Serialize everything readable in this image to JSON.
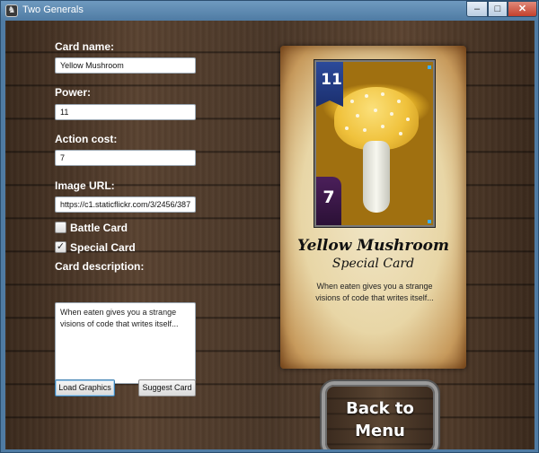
{
  "window": {
    "title": "Two Generals",
    "app_icon": "knight-helmet-icon",
    "buttons": {
      "minimize": "–",
      "maximize": "□",
      "close": "✕"
    }
  },
  "form": {
    "card_name_label": "Card name:",
    "card_name_value": "Yellow Mushroom",
    "power_label": "Power:",
    "power_value": "11",
    "action_cost_label": "Action cost:",
    "action_cost_value": "7",
    "image_url_label": "Image URL:",
    "image_url_value": "https://c1.staticflickr.com/3/2456/387",
    "battle_card_label": "Battle Card",
    "battle_card_checked": false,
    "special_card_label": "Special Card",
    "special_card_checked": true,
    "description_label": "Card description:",
    "description_value": "When eaten gives you a strange visions of code that writes itself...",
    "load_graphics_label": "Load Graphics",
    "suggest_card_label": "Suggest Card"
  },
  "card": {
    "power": "11",
    "cost": "7",
    "title": "Yellow Mushroom",
    "subtitle": "Special Card",
    "description": "When eaten gives you a strange visions of code that writes itself..."
  },
  "menu_button": {
    "line1": "Back to",
    "line2": "Menu"
  },
  "colors": {
    "titlebar": "#4f7ba3",
    "wood": "#4a3728",
    "parchment": "#e8d6a6",
    "power_banner": "#2c4a9a",
    "cost_badge": "#4b1f5a"
  }
}
